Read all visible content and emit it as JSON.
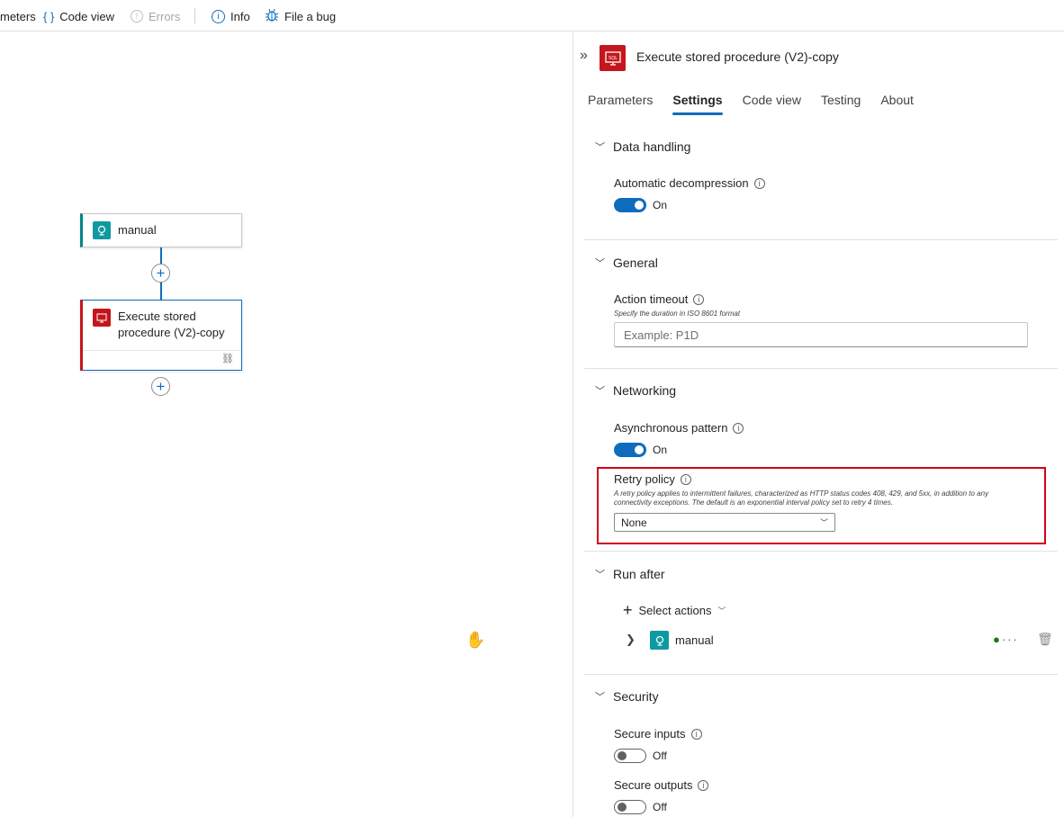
{
  "toolbar": {
    "parameters_label": "meters",
    "code_view_label": "Code view",
    "errors_label": "Errors",
    "info_label": "Info",
    "file_bug_label": "File a bug"
  },
  "canvas": {
    "trigger_title": "manual",
    "action_title_line1": "Execute stored",
    "action_title_line2": "procedure (V2)-copy"
  },
  "panel": {
    "title": "Execute stored procedure (V2)-copy",
    "tabs": [
      {
        "label": "Parameters"
      },
      {
        "label": "Settings"
      },
      {
        "label": "Code view"
      },
      {
        "label": "Testing"
      },
      {
        "label": "About"
      }
    ],
    "active_tab": "Settings",
    "data_handling": {
      "heading": "Data handling",
      "auto_decompression_label": "Automatic decompression",
      "auto_decompression_state": "On"
    },
    "general": {
      "heading": "General",
      "action_timeout_label": "Action timeout",
      "action_timeout_hint": "Specify the duration in ISO 8601 format",
      "action_timeout_placeholder": "Example: P1D"
    },
    "networking": {
      "heading": "Networking",
      "async_pattern_label": "Asynchronous pattern",
      "async_pattern_state": "On",
      "retry_policy_label": "Retry policy",
      "retry_policy_hint_line1": "A retry policy applies to intermittent failures, characterized as HTTP status codes 408, 429, and 5xx, in addition to any",
      "retry_policy_hint_line2": "connectivity exceptions. The default is an exponential interval policy set to retry 4 times.",
      "retry_policy_value": "None"
    },
    "run_after": {
      "heading": "Run after",
      "select_actions_label": "Select actions",
      "item_label": "manual"
    },
    "security": {
      "heading": "Security",
      "secure_inputs_label": "Secure inputs",
      "secure_inputs_state": "Off",
      "secure_outputs_label": "Secure outputs",
      "secure_outputs_state": "Off"
    }
  },
  "colors": {
    "accent": "#0f6cbd",
    "sql_red": "#c4161c",
    "trigger_teal": "#0e9aa0",
    "highlight": "#d0021b"
  }
}
